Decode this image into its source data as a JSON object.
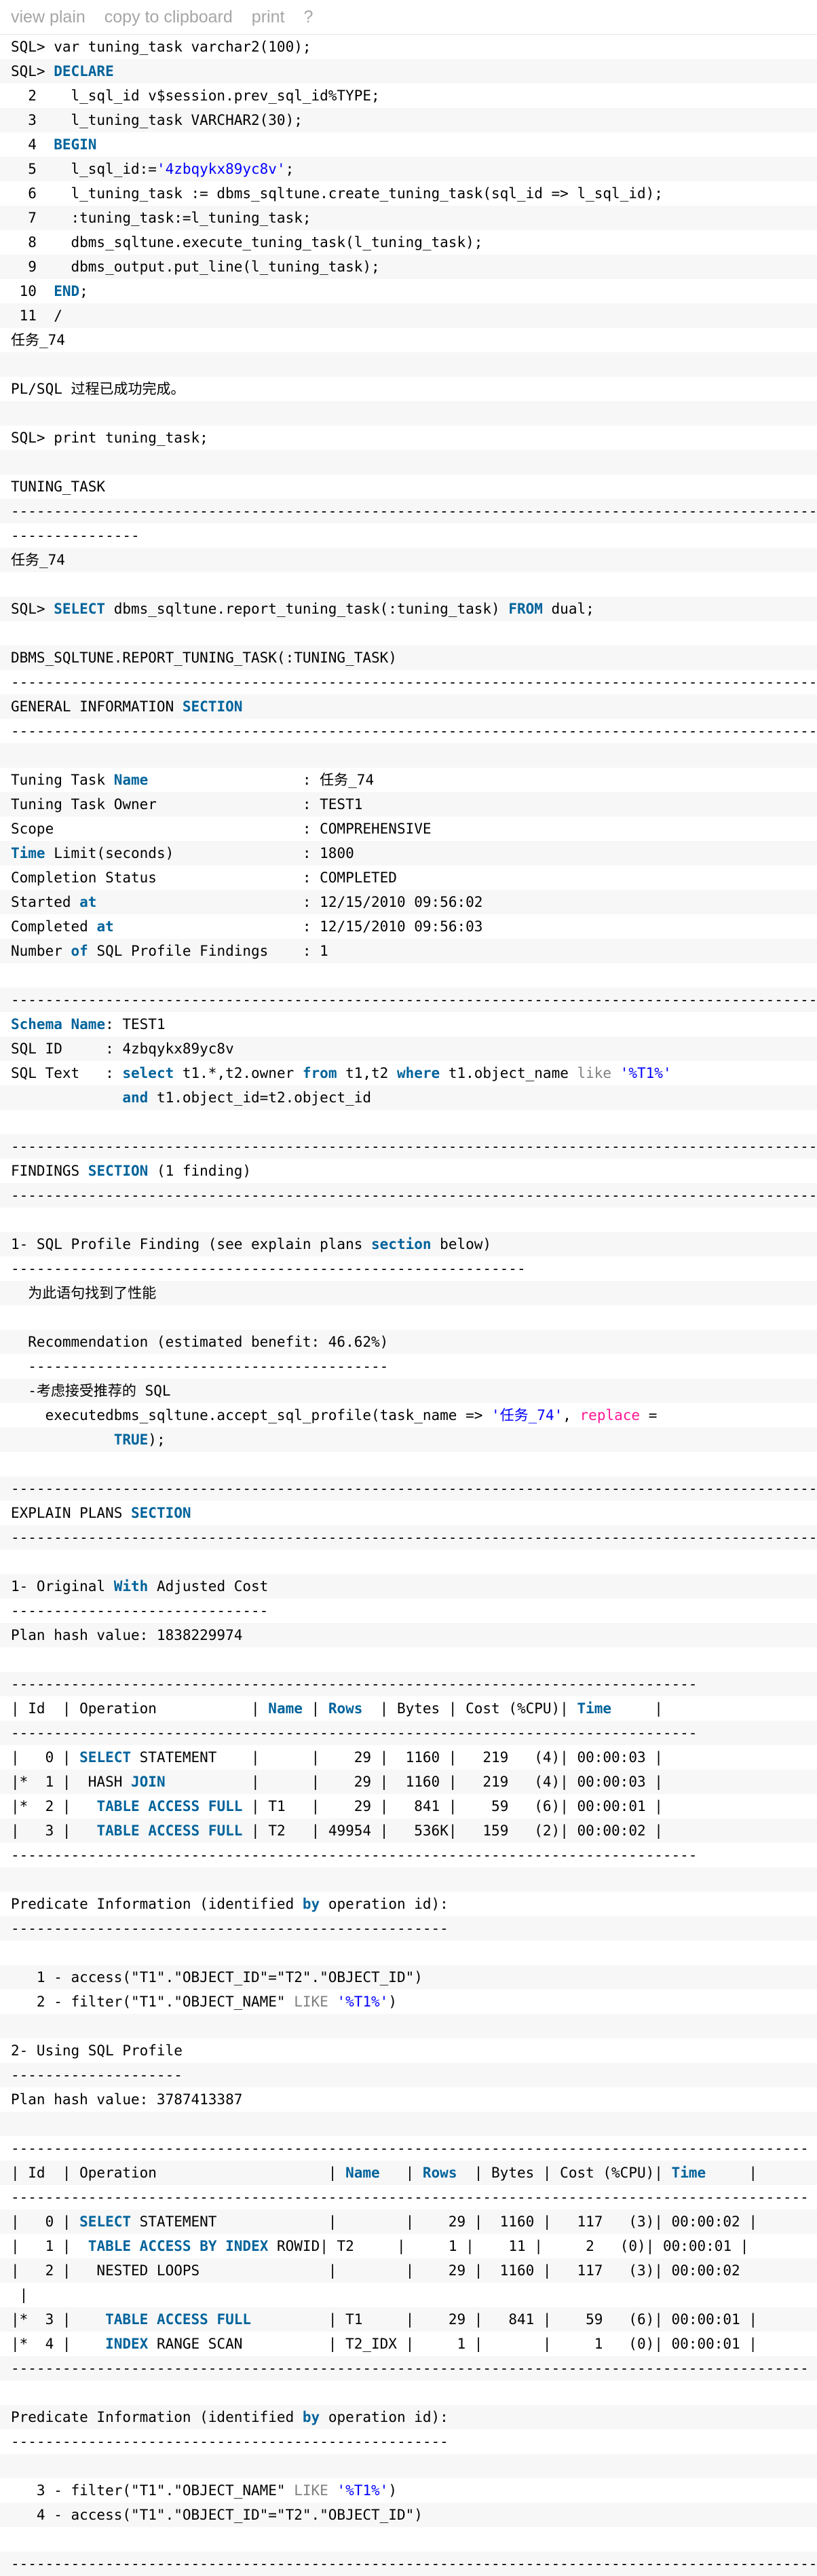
{
  "toolbar": {
    "view_plain": "view plain",
    "copy": "copy to clipboard",
    "print": "print",
    "help": "?"
  },
  "colors": {
    "keyword": "#00639b",
    "string": "#0000ff",
    "function": "#ff1493",
    "operator": "#808080",
    "alt_row": "#f7f7f7"
  },
  "code_lines": [
    "SQL> var tuning_task varchar2(100);",
    "SQL> DECLARE",
    "  2    l_sql_id v$session.prev_sql_id%TYPE;",
    "  3    l_tuning_task VARCHAR2(30);",
    "  4  BEGIN",
    "  5    l_sql_id:='4zbqykx89yc8v';",
    "  6    l_tuning_task := dbms_sqltune.create_tuning_task(sql_id => l_sql_id);",
    "  7    :tuning_task:=l_tuning_task;",
    "  8    dbms_sqltune.execute_tuning_task(l_tuning_task);",
    "  9    dbms_output.put_line(l_tuning_task);",
    " 10  END;",
    " 11  /",
    "任务_74",
    "",
    "PL/SQL 过程已成功完成。",
    "",
    "SQL> print tuning_task;",
    "",
    "TUNING_TASK",
    "------------------------------------------------------------------------------------------------------------",
    "---------------",
    "任务_74",
    "",
    "SQL> SELECT dbms_sqltune.report_tuning_task(:tuning_task) FROM dual;",
    "",
    "DBMS_SQLTUNE.REPORT_TUNING_TASK(:TUNING_TASK)",
    "-------------------------------------------------------------------------------------------------",
    "GENERAL INFORMATION SECTION",
    "-------------------------------------------------------------------------------------------------",
    "",
    "Tuning Task Name                  : 任务_74",
    "Tuning Task Owner                 : TEST1",
    "Scope                             : COMPREHENSIVE",
    "Time Limit(seconds)               : 1800",
    "Completion Status                 : COMPLETED",
    "Started at                        : 12/15/2010 09:56:02",
    "Completed at                      : 12/15/2010 09:56:03",
    "Number of SQL Profile Findings    : 1",
    "",
    "-------------------------------------------------------------------------------------------------",
    "Schema Name: TEST1",
    "SQL ID     : 4zbqykx89yc8v",
    "SQL Text   : select t1.*,t2.owner from t1,t2 where t1.object_name like '%T1%'",
    "             and t1.object_id=t2.object_id",
    "",
    "-------------------------------------------------------------------------------------------------",
    "FINDINGS SECTION (1 finding)",
    "-------------------------------------------------------------------------------------------------",
    "",
    "1- SQL Profile Finding (see explain plans section below)",
    "------------------------------------------------------------",
    "  为此语句找到了性能",
    "",
    "  Recommendation (estimated benefit: 46.62%)",
    "  ------------------------------------------",
    "  -考虑接受推荐的 SQL",
    "    executedbms_sqltune.accept_sql_profile(task_name => '任务_74', replace =",
    "            TRUE);",
    "",
    "-------------------------------------------------------------------------------------------------",
    "EXPLAIN PLANS SECTION",
    "-------------------------------------------------------------------------------------------------",
    "",
    "1- Original With Adjusted Cost",
    "------------------------------",
    "Plan hash value: 1838229974",
    "",
    "--------------------------------------------------------------------------------",
    "| Id  | Operation           | Name | Rows  | Bytes | Cost (%CPU)| Time     |",
    "--------------------------------------------------------------------------------",
    "|   0 | SELECT STATEMENT    |      |    29 |  1160 |   219   (4)| 00:00:03 |",
    "|*  1 |  HASH JOIN          |      |    29 |  1160 |   219   (4)| 00:00:03 |",
    "|*  2 |   TABLE ACCESS FULL | T1   |    29 |   841 |    59   (6)| 00:00:01 |",
    "|   3 |   TABLE ACCESS FULL | T2   | 49954 |   536K|   159   (2)| 00:00:02 |",
    "--------------------------------------------------------------------------------",
    "",
    "Predicate Information (identified by operation id):",
    "---------------------------------------------------",
    "",
    "   1 - access(\"T1\".\"OBJECT_ID\"=\"T2\".\"OBJECT_ID\")",
    "   2 - filter(\"T1\".\"OBJECT_NAME\" LIKE '%T1%')",
    "",
    "2- Using SQL Profile",
    "--------------------",
    "Plan hash value: 3787413387",
    "",
    "---------------------------------------------------------------------------------------------",
    "| Id  | Operation                    | Name   | Rows  | Bytes | Cost (%CPU)| Time     |",
    "---------------------------------------------------------------------------------------------",
    "|   0 | SELECT STATEMENT             |        |    29 |  1160 |   117   (3)| 00:00:02 |",
    "|   1 |  TABLE ACCESS BY INDEX ROWID| T2     |     1 |    11 |     2   (0)| 00:00:01 |",
    "|   2 |   NESTED LOOPS               |        |    29 |  1160 |   117   (3)| 00:00:02",
    " |",
    "|*  3 |    TABLE ACCESS FULL         | T1     |    29 |   841 |    59   (6)| 00:00:01 |",
    "|*  4 |    INDEX RANGE SCAN          | T2_IDX |     1 |       |     1   (0)| 00:00:01 |",
    "---------------------------------------------------------------------------------------------",
    "",
    "Predicate Information (identified by operation id):",
    "---------------------------------------------------",
    "",
    "   3 - filter(\"T1\".\"OBJECT_NAME\" LIKE '%T1%')",
    "   4 - access(\"T1\".\"OBJECT_ID\"=\"T2\".\"OBJECT_ID\")",
    "",
    "-------------------------------------------------------------------------------------------------"
  ]
}
